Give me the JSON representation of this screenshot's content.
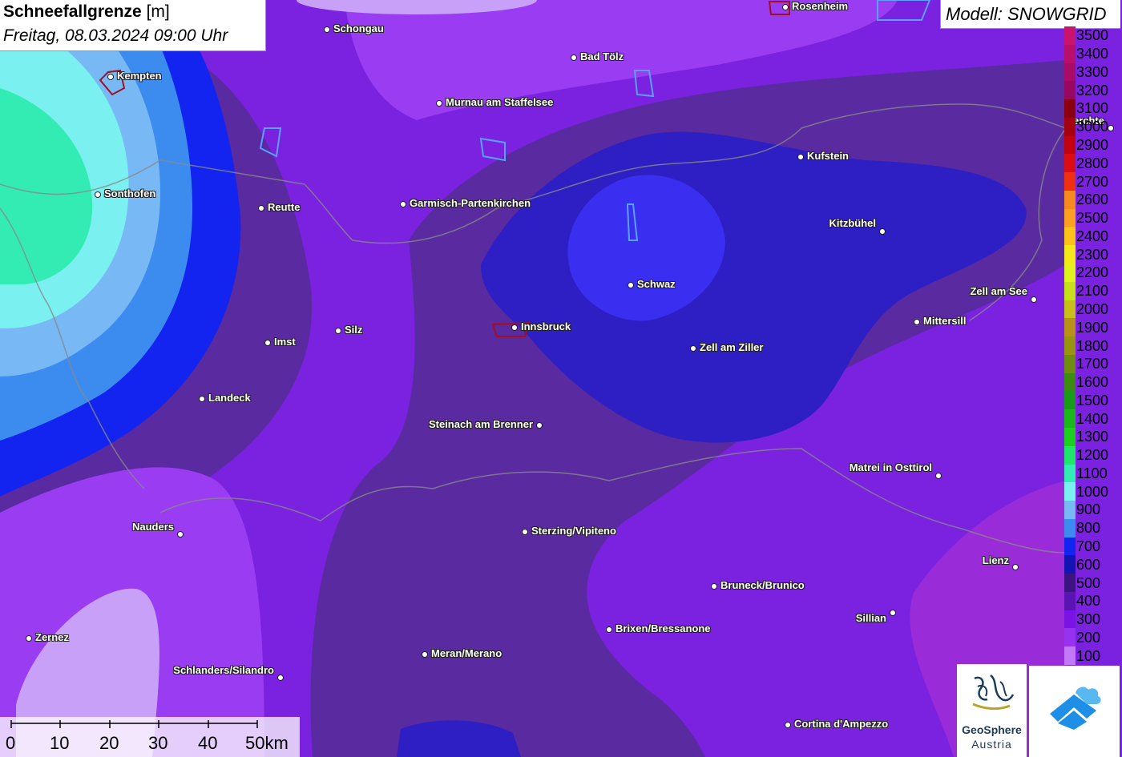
{
  "header": {
    "title_bold": "Schneefallgrenze",
    "title_unit": "[m]",
    "datetime": "Freitag, 08.03.2024 09:00 Uhr"
  },
  "model": {
    "label": "Modell: SNOWGRID"
  },
  "legend": {
    "levels": [
      {
        "value": "3500",
        "color": "#c8146e"
      },
      {
        "value": "3400",
        "color": "#b8106a"
      },
      {
        "value": "3300",
        "color": "#a80c66"
      },
      {
        "value": "3200",
        "color": "#980862"
      },
      {
        "value": "3100",
        "color": "#8a0010"
      },
      {
        "value": "3000",
        "color": "#a50010"
      },
      {
        "value": "2900",
        "color": "#c20010"
      },
      {
        "value": "2800",
        "color": "#dc0c14"
      },
      {
        "value": "2700",
        "color": "#f03010"
      },
      {
        "value": "2600",
        "color": "#f68a1e"
      },
      {
        "value": "2500",
        "color": "#fba020"
      },
      {
        "value": "2400",
        "color": "#fdc21a"
      },
      {
        "value": "2300",
        "color": "#f2e81a"
      },
      {
        "value": "2200",
        "color": "#e2f21e"
      },
      {
        "value": "2100",
        "color": "#c8e01c"
      },
      {
        "value": "2000",
        "color": "#c8c01a"
      },
      {
        "value": "1900",
        "color": "#b8901a"
      },
      {
        "value": "1800",
        "color": "#989410"
      },
      {
        "value": "1700",
        "color": "#6f8c10"
      },
      {
        "value": "1600",
        "color": "#3c8c14"
      },
      {
        "value": "1500",
        "color": "#1a9a1a"
      },
      {
        "value": "1400",
        "color": "#1ab81a"
      },
      {
        "value": "1300",
        "color": "#1ed01e"
      },
      {
        "value": "1200",
        "color": "#1ee66a"
      },
      {
        "value": "1100",
        "color": "#32ecb4"
      },
      {
        "value": "1000",
        "color": "#7af0f0"
      },
      {
        "value": "900",
        "color": "#78b8f4"
      },
      {
        "value": "800",
        "color": "#3c8cf0"
      },
      {
        "value": "700",
        "color": "#1424f0"
      },
      {
        "value": "600",
        "color": "#1414b4"
      },
      {
        "value": "500",
        "color": "#3c1482"
      },
      {
        "value": "400",
        "color": "#5a14b4"
      },
      {
        "value": "300",
        "color": "#7a14e6"
      },
      {
        "value": "200",
        "color": "#9632f0"
      },
      {
        "value": "100",
        "color": "#c378fa"
      }
    ]
  },
  "places": [
    {
      "name": "Rosenheim",
      "label_side": "right"
    },
    {
      "name": "Schongau",
      "label_side": "right"
    },
    {
      "name": "Bad Tölz",
      "label_side": "right"
    },
    {
      "name": "Kempten",
      "label_side": "right"
    },
    {
      "name": "Murnau am Staffelsee",
      "label_side": "right"
    },
    {
      "name": "Berchte",
      "label_side": "left"
    },
    {
      "name": "Kufstein",
      "label_side": "right"
    },
    {
      "name": "Sonthofen",
      "label_side": "right"
    },
    {
      "name": "Reutte",
      "label_side": "right"
    },
    {
      "name": "Garmisch-Partenkirchen",
      "label_side": "right"
    },
    {
      "name": "Kitzbühel",
      "label_side": "left"
    },
    {
      "name": "Schwaz",
      "label_side": "right"
    },
    {
      "name": "Zell am See",
      "label_side": "left"
    },
    {
      "name": "Innsbruck",
      "label_side": "right"
    },
    {
      "name": "Silz",
      "label_side": "right"
    },
    {
      "name": "Mittersill",
      "label_side": "right"
    },
    {
      "name": "Imst",
      "label_side": "right"
    },
    {
      "name": "Zell am Ziller",
      "label_side": "right"
    },
    {
      "name": "Landeck",
      "label_side": "right"
    },
    {
      "name": "Steinach am Brenner",
      "label_side": "left"
    },
    {
      "name": "Matrei in Osttirol",
      "label_side": "left"
    },
    {
      "name": "Nauders",
      "label_side": "left"
    },
    {
      "name": "Sterzing/Vipiteno",
      "label_side": "right"
    },
    {
      "name": "Lienz",
      "label_side": "left"
    },
    {
      "name": "Bruneck/Brunico",
      "label_side": "right"
    },
    {
      "name": "Sillian",
      "label_side": "left"
    },
    {
      "name": "Brixen/Bressanone",
      "label_side": "right"
    },
    {
      "name": "Zernez",
      "label_side": "right"
    },
    {
      "name": "Meran/Merano",
      "label_side": "right"
    },
    {
      "name": "Schlanders/Silandro",
      "label_side": "left"
    },
    {
      "name": "Cortina d'Ampezzo",
      "label_side": "right"
    }
  ],
  "scale_bar": {
    "labels": [
      "0",
      "10",
      "20",
      "30",
      "40",
      "50km"
    ]
  },
  "logos": {
    "geosphere_line1": "GeoSphere",
    "geosphere_line2": "Austria"
  }
}
